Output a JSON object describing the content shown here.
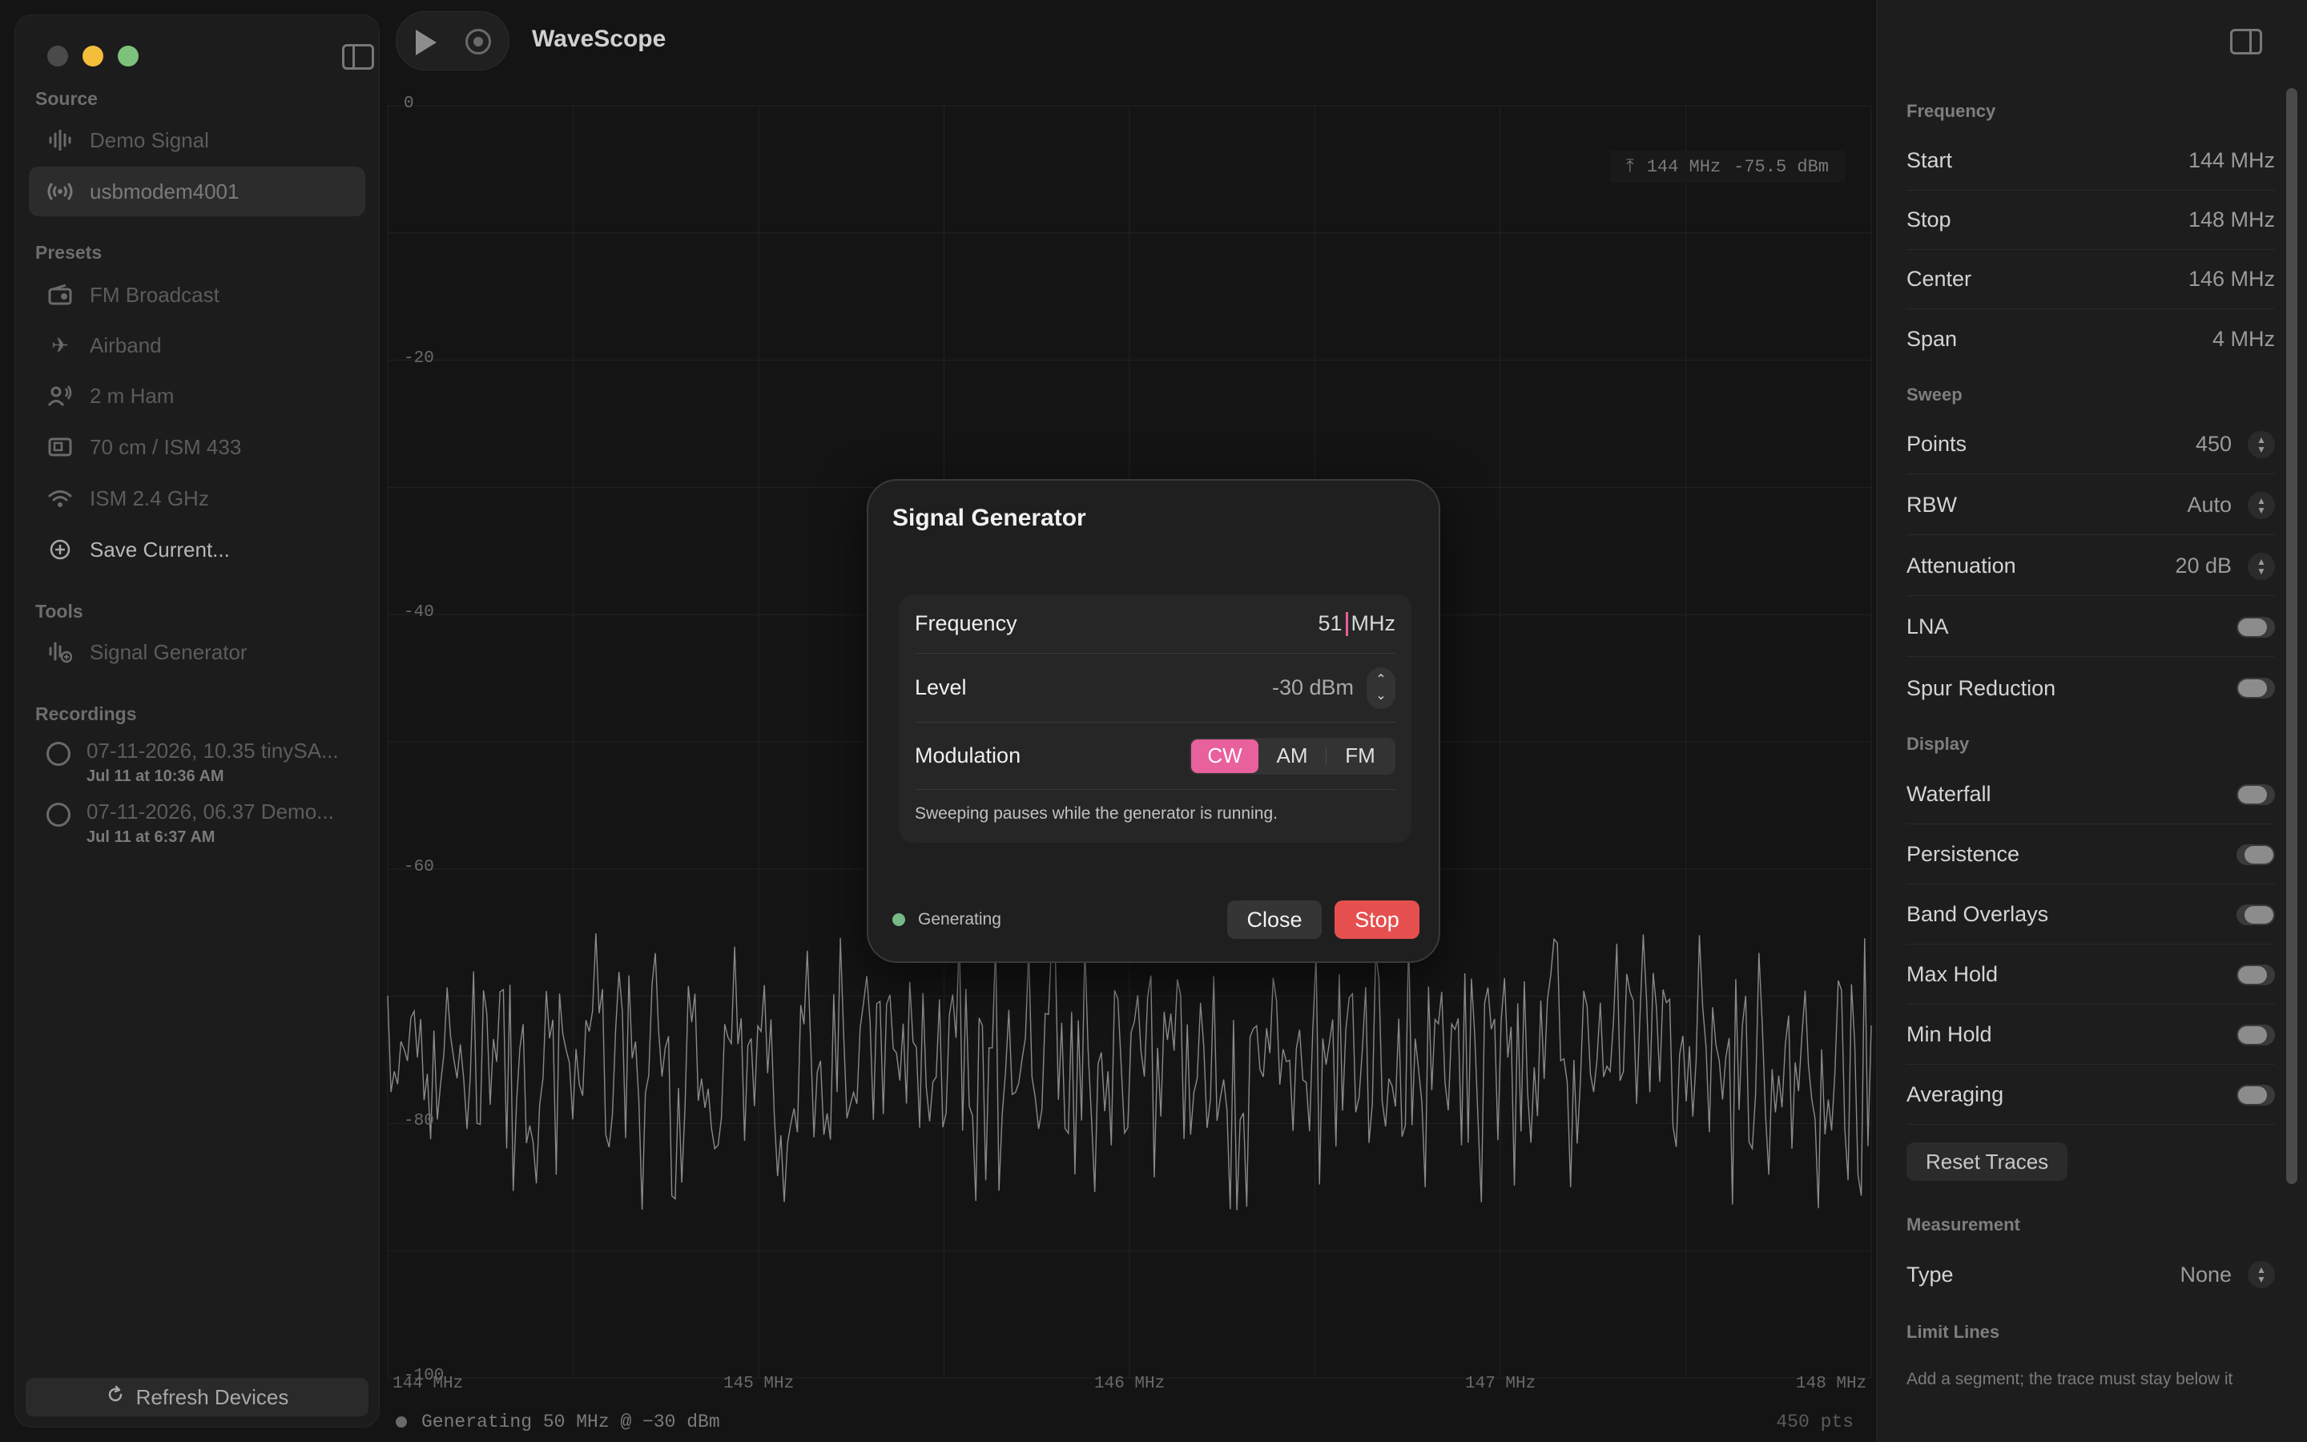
{
  "app": {
    "title": "WaveScope"
  },
  "sidebar": {
    "sections": {
      "source": "Source",
      "presets": "Presets",
      "tools": "Tools",
      "recordings": "Recordings"
    },
    "source_items": [
      {
        "label": "Demo Signal",
        "icon": "waveform-icon"
      },
      {
        "label": "usbmodem4001",
        "icon": "antenna-icon"
      }
    ],
    "preset_items": [
      {
        "label": "FM Broadcast",
        "icon": "radio-icon"
      },
      {
        "label": "Airband",
        "icon": "airplane-icon"
      },
      {
        "label": "2 m Ham",
        "icon": "person-wave-icon"
      },
      {
        "label": "70 cm / ISM 433",
        "icon": "device-icon"
      },
      {
        "label": "ISM 2.4 GHz",
        "icon": "wifi-icon"
      },
      {
        "label": "Save Current...",
        "icon": "plus-circle-icon"
      }
    ],
    "tool_items": [
      {
        "label": "Signal Generator",
        "icon": "generator-icon"
      }
    ],
    "recordings": [
      {
        "title": "07-11-2026, 10.35 tinySA...",
        "date": "Jul 11 at 10:36 AM"
      },
      {
        "title": "07-11-2026, 06.37 Demo...",
        "date": "Jul 11 at 6:37 AM"
      }
    ],
    "refresh_label": "Refresh Devices"
  },
  "plot": {
    "y_ticks": [
      "0",
      "-20",
      "-40",
      "-60",
      "-80",
      "-100"
    ],
    "x_ticks": [
      "144 MHz",
      "145 MHz",
      "146 MHz",
      "147 MHz",
      "148 MHz"
    ],
    "marker": {
      "freq": "144 MHz",
      "level": "-75.5 dBm"
    },
    "status": "Generating 50 MHz @ −30 dBm",
    "points_label": "450 pts",
    "trace_color": "#8a8a8a"
  },
  "chart_data": {
    "type": "line",
    "title": "",
    "xlabel": "",
    "ylabel": "",
    "xlim": [
      144,
      148
    ],
    "ylim": [
      -100,
      0
    ],
    "x_unit": "MHz",
    "y_unit": "dBm",
    "series": [
      {
        "points": 450,
        "level_min": -85,
        "level_max": -65,
        "peak_near_start": -67
      }
    ]
  },
  "inspector": {
    "frequency": {
      "title": "Frequency",
      "rows": [
        {
          "label": "Start",
          "value": "144 MHz"
        },
        {
          "label": "Stop",
          "value": "148 MHz"
        },
        {
          "label": "Center",
          "value": "146 MHz"
        },
        {
          "label": "Span",
          "value": "4 MHz"
        }
      ]
    },
    "sweep": {
      "title": "Sweep",
      "rows": [
        {
          "label": "Points",
          "value": "450"
        },
        {
          "label": "RBW",
          "value": "Auto"
        },
        {
          "label": "Attenuation",
          "value": "20 dB"
        },
        {
          "label": "LNA"
        },
        {
          "label": "Spur Reduction"
        }
      ]
    },
    "display": {
      "title": "Display",
      "rows": [
        {
          "label": "Waterfall",
          "on": false
        },
        {
          "label": "Persistence",
          "on": true
        },
        {
          "label": "Band Overlays",
          "on": true
        },
        {
          "label": "Max Hold",
          "on": false
        },
        {
          "label": "Min Hold",
          "on": false
        },
        {
          "label": "Averaging",
          "on": false
        }
      ],
      "reset_label": "Reset Traces"
    },
    "measurement": {
      "title": "Measurement",
      "type_label": "Type",
      "type_value": "None"
    },
    "limit_lines": {
      "title": "Limit Lines",
      "help": "Add a segment; the trace must stay below it"
    }
  },
  "dialog": {
    "title": "Signal Generator",
    "frequency_label": "Frequency",
    "frequency_value": "51",
    "frequency_unit": "MHz",
    "level_label": "Level",
    "level_value": "-30 dBm",
    "modulation_label": "Modulation",
    "modulation_options": [
      "CW",
      "AM",
      "FM"
    ],
    "modulation_selected": "CW",
    "note": "Sweeping pauses while the generator is running.",
    "status": "Generating",
    "close_label": "Close",
    "stop_label": "Stop",
    "accent": "#e8609c",
    "stop_color": "#e5504f"
  }
}
